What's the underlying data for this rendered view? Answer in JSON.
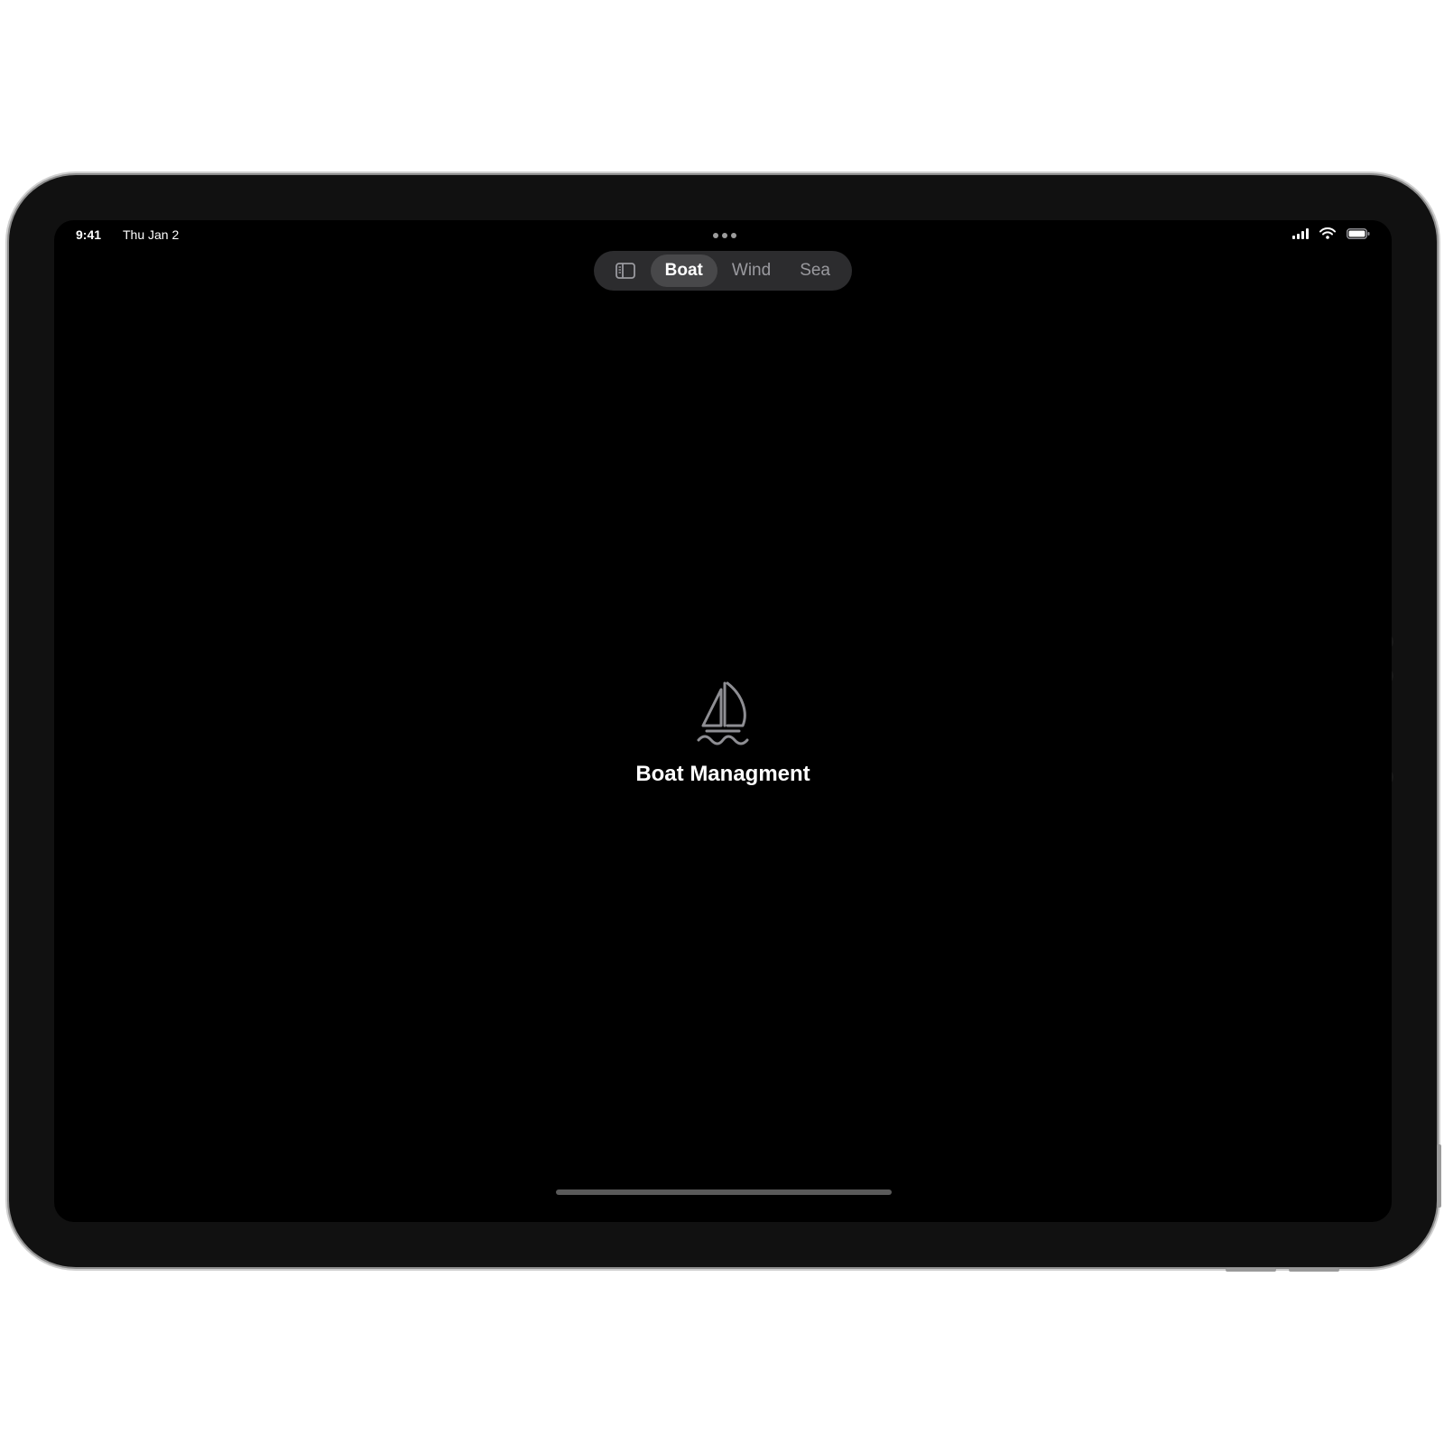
{
  "status_bar": {
    "time": "9:41",
    "date": "Thu Jan 2"
  },
  "icons": {
    "multitasking": "more-dots-icon",
    "sidebar_toggle": "sidebar-icon",
    "signal": "cellular-signal-icon",
    "wifi": "wifi-icon",
    "battery": "battery-icon",
    "empty_state": "sailboat-icon"
  },
  "tab_bar": {
    "selected": "Boat",
    "tabs": [
      {
        "label": "Boat"
      },
      {
        "label": "Wind"
      },
      {
        "label": "Sea"
      }
    ]
  },
  "empty_state": {
    "title": "Boat Managment"
  },
  "colors": {
    "screen_background": "#000000",
    "tab_bar_background": "#2c2c2e",
    "selected_tab_background": "#48484a",
    "inactive_text": "#9a9a9f",
    "icon_gray": "#8e8e93"
  }
}
